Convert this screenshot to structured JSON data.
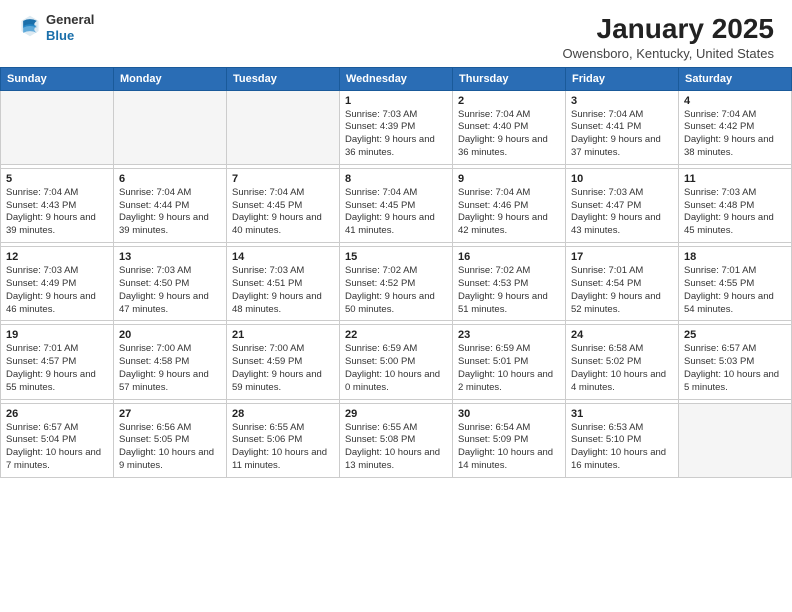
{
  "header": {
    "logo_general": "General",
    "logo_blue": "Blue",
    "month_title": "January 2025",
    "location": "Owensboro, Kentucky, United States"
  },
  "weekdays": [
    "Sunday",
    "Monday",
    "Tuesday",
    "Wednesday",
    "Thursday",
    "Friday",
    "Saturday"
  ],
  "weeks": [
    [
      {
        "day": "",
        "info": ""
      },
      {
        "day": "",
        "info": ""
      },
      {
        "day": "",
        "info": ""
      },
      {
        "day": "1",
        "info": "Sunrise: 7:03 AM\nSunset: 4:39 PM\nDaylight: 9 hours and 36 minutes."
      },
      {
        "day": "2",
        "info": "Sunrise: 7:04 AM\nSunset: 4:40 PM\nDaylight: 9 hours and 36 minutes."
      },
      {
        "day": "3",
        "info": "Sunrise: 7:04 AM\nSunset: 4:41 PM\nDaylight: 9 hours and 37 minutes."
      },
      {
        "day": "4",
        "info": "Sunrise: 7:04 AM\nSunset: 4:42 PM\nDaylight: 9 hours and 38 minutes."
      }
    ],
    [
      {
        "day": "5",
        "info": "Sunrise: 7:04 AM\nSunset: 4:43 PM\nDaylight: 9 hours and 39 minutes."
      },
      {
        "day": "6",
        "info": "Sunrise: 7:04 AM\nSunset: 4:44 PM\nDaylight: 9 hours and 39 minutes."
      },
      {
        "day": "7",
        "info": "Sunrise: 7:04 AM\nSunset: 4:45 PM\nDaylight: 9 hours and 40 minutes."
      },
      {
        "day": "8",
        "info": "Sunrise: 7:04 AM\nSunset: 4:45 PM\nDaylight: 9 hours and 41 minutes."
      },
      {
        "day": "9",
        "info": "Sunrise: 7:04 AM\nSunset: 4:46 PM\nDaylight: 9 hours and 42 minutes."
      },
      {
        "day": "10",
        "info": "Sunrise: 7:03 AM\nSunset: 4:47 PM\nDaylight: 9 hours and 43 minutes."
      },
      {
        "day": "11",
        "info": "Sunrise: 7:03 AM\nSunset: 4:48 PM\nDaylight: 9 hours and 45 minutes."
      }
    ],
    [
      {
        "day": "12",
        "info": "Sunrise: 7:03 AM\nSunset: 4:49 PM\nDaylight: 9 hours and 46 minutes."
      },
      {
        "day": "13",
        "info": "Sunrise: 7:03 AM\nSunset: 4:50 PM\nDaylight: 9 hours and 47 minutes."
      },
      {
        "day": "14",
        "info": "Sunrise: 7:03 AM\nSunset: 4:51 PM\nDaylight: 9 hours and 48 minutes."
      },
      {
        "day": "15",
        "info": "Sunrise: 7:02 AM\nSunset: 4:52 PM\nDaylight: 9 hours and 50 minutes."
      },
      {
        "day": "16",
        "info": "Sunrise: 7:02 AM\nSunset: 4:53 PM\nDaylight: 9 hours and 51 minutes."
      },
      {
        "day": "17",
        "info": "Sunrise: 7:01 AM\nSunset: 4:54 PM\nDaylight: 9 hours and 52 minutes."
      },
      {
        "day": "18",
        "info": "Sunrise: 7:01 AM\nSunset: 4:55 PM\nDaylight: 9 hours and 54 minutes."
      }
    ],
    [
      {
        "day": "19",
        "info": "Sunrise: 7:01 AM\nSunset: 4:57 PM\nDaylight: 9 hours and 55 minutes."
      },
      {
        "day": "20",
        "info": "Sunrise: 7:00 AM\nSunset: 4:58 PM\nDaylight: 9 hours and 57 minutes."
      },
      {
        "day": "21",
        "info": "Sunrise: 7:00 AM\nSunset: 4:59 PM\nDaylight: 9 hours and 59 minutes."
      },
      {
        "day": "22",
        "info": "Sunrise: 6:59 AM\nSunset: 5:00 PM\nDaylight: 10 hours and 0 minutes."
      },
      {
        "day": "23",
        "info": "Sunrise: 6:59 AM\nSunset: 5:01 PM\nDaylight: 10 hours and 2 minutes."
      },
      {
        "day": "24",
        "info": "Sunrise: 6:58 AM\nSunset: 5:02 PM\nDaylight: 10 hours and 4 minutes."
      },
      {
        "day": "25",
        "info": "Sunrise: 6:57 AM\nSunset: 5:03 PM\nDaylight: 10 hours and 5 minutes."
      }
    ],
    [
      {
        "day": "26",
        "info": "Sunrise: 6:57 AM\nSunset: 5:04 PM\nDaylight: 10 hours and 7 minutes."
      },
      {
        "day": "27",
        "info": "Sunrise: 6:56 AM\nSunset: 5:05 PM\nDaylight: 10 hours and 9 minutes."
      },
      {
        "day": "28",
        "info": "Sunrise: 6:55 AM\nSunset: 5:06 PM\nDaylight: 10 hours and 11 minutes."
      },
      {
        "day": "29",
        "info": "Sunrise: 6:55 AM\nSunset: 5:08 PM\nDaylight: 10 hours and 13 minutes."
      },
      {
        "day": "30",
        "info": "Sunrise: 6:54 AM\nSunset: 5:09 PM\nDaylight: 10 hours and 14 minutes."
      },
      {
        "day": "31",
        "info": "Sunrise: 6:53 AM\nSunset: 5:10 PM\nDaylight: 10 hours and 16 minutes."
      },
      {
        "day": "",
        "info": ""
      }
    ]
  ]
}
